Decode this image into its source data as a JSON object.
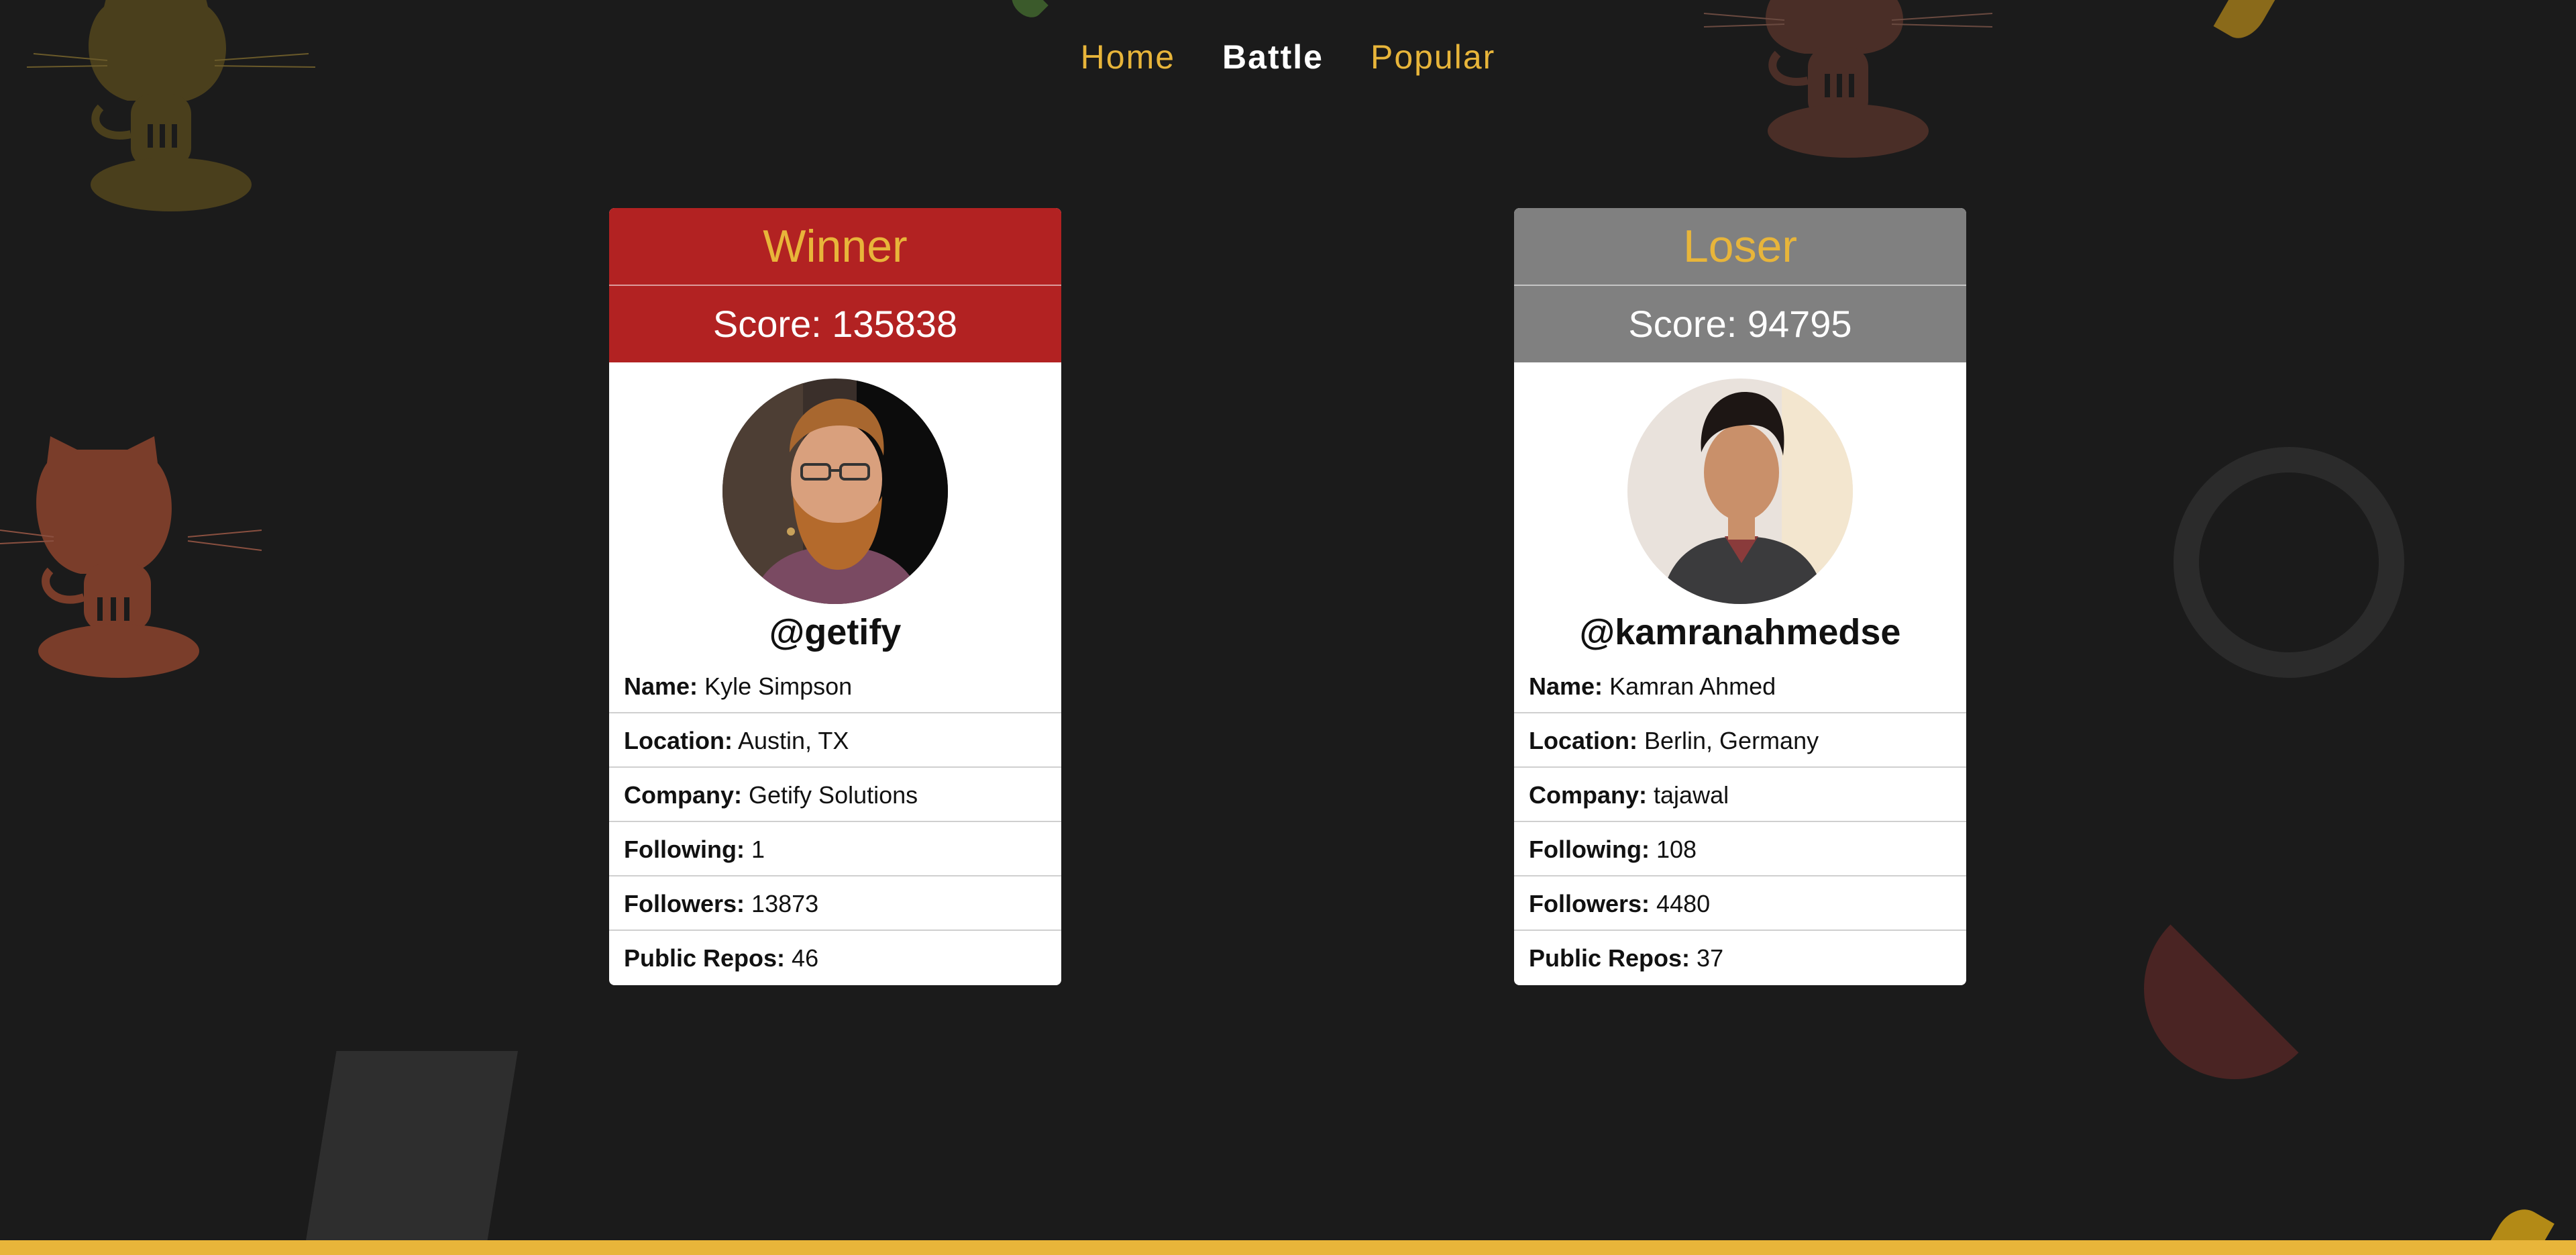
{
  "nav": {
    "home": "Home",
    "battle": "Battle",
    "popular": "Popular"
  },
  "players": [
    {
      "status": "Winner",
      "score_text": "Score: 135838",
      "handle": "@getify",
      "fields": [
        {
          "label": "Name:",
          "value": "Kyle Simpson"
        },
        {
          "label": "Location:",
          "value": "Austin, TX"
        },
        {
          "label": "Company:",
          "value": "Getify Solutions"
        },
        {
          "label": "Following:",
          "value": "1"
        },
        {
          "label": "Followers:",
          "value": "13873"
        },
        {
          "label": "Public Repos:",
          "value": "46"
        }
      ]
    },
    {
      "status": "Loser",
      "score_text": "Score: 94795",
      "handle": "@kamranahmedse",
      "fields": [
        {
          "label": "Name:",
          "value": "Kamran Ahmed"
        },
        {
          "label": "Location:",
          "value": "Berlin, Germany"
        },
        {
          "label": "Company:",
          "value": "tajawal"
        },
        {
          "label": "Following:",
          "value": "108"
        },
        {
          "label": "Followers:",
          "value": "4480"
        },
        {
          "label": "Public Repos:",
          "value": "37"
        }
      ]
    }
  ],
  "colors": {
    "background": "#1b1b1b",
    "accent": "#e8b53a",
    "winner": "#b22222",
    "loser": "#808080"
  }
}
